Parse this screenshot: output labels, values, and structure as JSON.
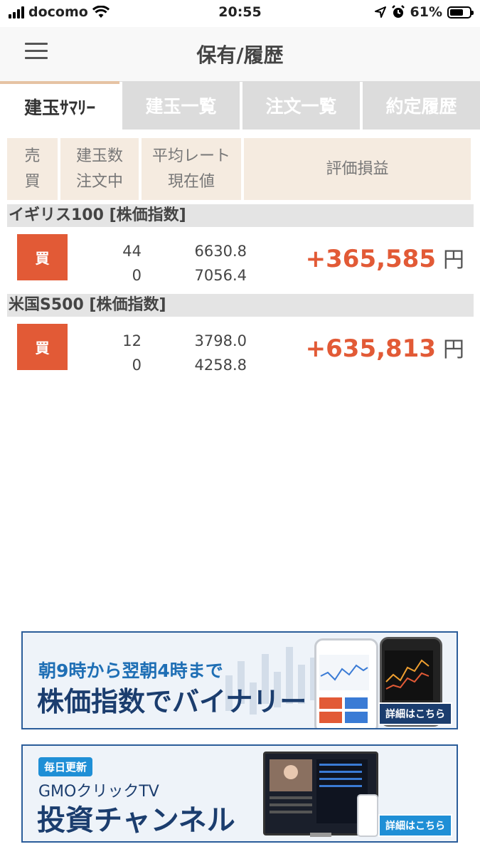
{
  "status_bar": {
    "carrier": "docomo",
    "time": "20:55",
    "battery": "61%",
    "battery_level": 0.61
  },
  "header": {
    "title": "保有/履歴"
  },
  "tabs": [
    {
      "label": "建玉ｻﾏﾘｰ",
      "active": true
    },
    {
      "label": "建玉一覧",
      "active": false
    },
    {
      "label": "注文一覧",
      "active": false
    },
    {
      "label": "約定履歴",
      "active": false
    }
  ],
  "table_header": {
    "col1": [
      "売",
      "買"
    ],
    "col2": [
      "建玉数",
      "注文中"
    ],
    "col3": [
      "平均レート",
      "現在値"
    ],
    "col4": "評価損益"
  },
  "positions": [
    {
      "name": "イギリス100 [株価指数]",
      "side": "買",
      "quantity": "44",
      "pending": "0",
      "avg_rate": "6630.8",
      "current": "7056.4",
      "pl": "+365,585",
      "unit": "円"
    },
    {
      "name": "米国S500 [株価指数]",
      "side": "買",
      "quantity": "12",
      "pending": "0",
      "avg_rate": "3798.0",
      "current": "4258.8",
      "pl": "+635,813",
      "unit": "円"
    }
  ],
  "banners": [
    {
      "line1": "朝9時から翌朝4時まで",
      "line2": "株価指数でバイナリー",
      "button": "詳細はこちら"
    },
    {
      "badge": "毎日更新",
      "line1": "GMOクリックTV",
      "line2": "投資チャンネル",
      "button": "詳細はこちら"
    }
  ],
  "colors": {
    "accent_red": "#e25a36",
    "header_bg": "#f5ebe0",
    "banner_navy": "#1b3d6e"
  }
}
